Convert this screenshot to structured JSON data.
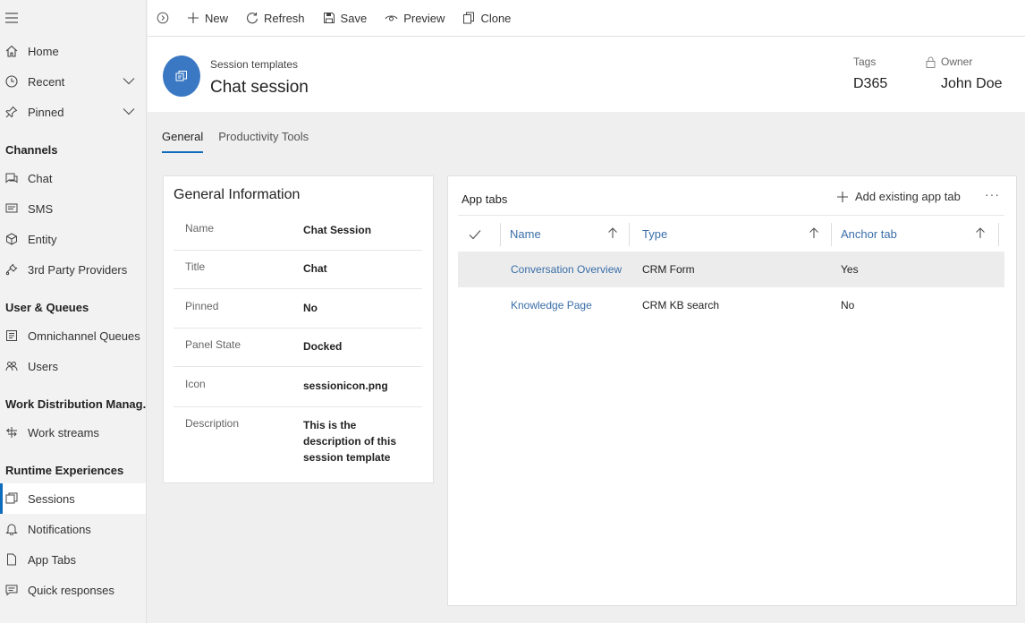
{
  "sidebar": {
    "items": [
      {
        "label": "Home",
        "icon": "home-icon"
      },
      {
        "label": "Recent",
        "icon": "clock-icon",
        "expandable": true
      },
      {
        "label": "Pinned",
        "icon": "pin-icon",
        "expandable": true
      }
    ],
    "groups": [
      {
        "title": "Channels",
        "items": [
          {
            "label": "Chat",
            "icon": "chat-icon"
          },
          {
            "label": "SMS",
            "icon": "sms-icon"
          },
          {
            "label": "Entity",
            "icon": "entity-icon"
          },
          {
            "label": "3rd Party Providers",
            "icon": "plug-icon"
          }
        ]
      },
      {
        "title": "User & Queues",
        "items": [
          {
            "label": "Omnichannel Queues",
            "icon": "queue-icon"
          },
          {
            "label": "Users",
            "icon": "users-icon"
          }
        ]
      },
      {
        "title": "Work Distribution Manag...",
        "items": [
          {
            "label": "Work streams",
            "icon": "workstream-icon"
          }
        ]
      },
      {
        "title": "Runtime Experiences",
        "items": [
          {
            "label": "Sessions",
            "icon": "sessions-icon",
            "active": true
          },
          {
            "label": "Notifications",
            "icon": "bell-icon"
          },
          {
            "label": "App Tabs",
            "icon": "page-icon"
          },
          {
            "label": "Quick responses",
            "icon": "message-icon"
          }
        ]
      }
    ]
  },
  "commands": [
    {
      "label": "New",
      "icon": "plus-icon"
    },
    {
      "label": "Refresh",
      "icon": "refresh-icon"
    },
    {
      "label": "Save",
      "icon": "save-icon"
    },
    {
      "label": "Preview",
      "icon": "eye-icon"
    },
    {
      "label": "Clone",
      "icon": "copy-icon"
    }
  ],
  "header": {
    "entity_type": "Session templates",
    "title": "Chat session",
    "tags_label": "Tags",
    "tags_value": "D365",
    "owner_label": "Owner",
    "owner_value": "John Doe"
  },
  "tabs": [
    {
      "label": "General",
      "active": true
    },
    {
      "label": "Productivity Tools",
      "active": false
    }
  ],
  "general_info": {
    "title": "General Information",
    "fields": [
      {
        "label": "Name",
        "value": "Chat Session"
      },
      {
        "label": "Title",
        "value": "Chat"
      },
      {
        "label": "Pinned",
        "value": "No"
      },
      {
        "label": "Panel State",
        "value": "Docked"
      },
      {
        "label": "Icon",
        "value": "sessionicon.png"
      },
      {
        "label": "Description",
        "value": "This is the description of this session template"
      }
    ]
  },
  "app_tabs": {
    "title": "App tabs",
    "add_label": "Add existing app tab",
    "more_label": "···",
    "columns": [
      "Name",
      "Type",
      "Anchor tab"
    ],
    "rows": [
      {
        "name": "Conversation Overview",
        "type": "CRM Form",
        "anchor": "Yes",
        "selected": true
      },
      {
        "name": "Knowledge Page",
        "type": "CRM KB search",
        "anchor": "No",
        "selected": false
      }
    ]
  },
  "colors": {
    "accent": "#0f6cbd",
    "entity_icon_bg": "#3a78c3",
    "link": "#3a6ea8"
  }
}
